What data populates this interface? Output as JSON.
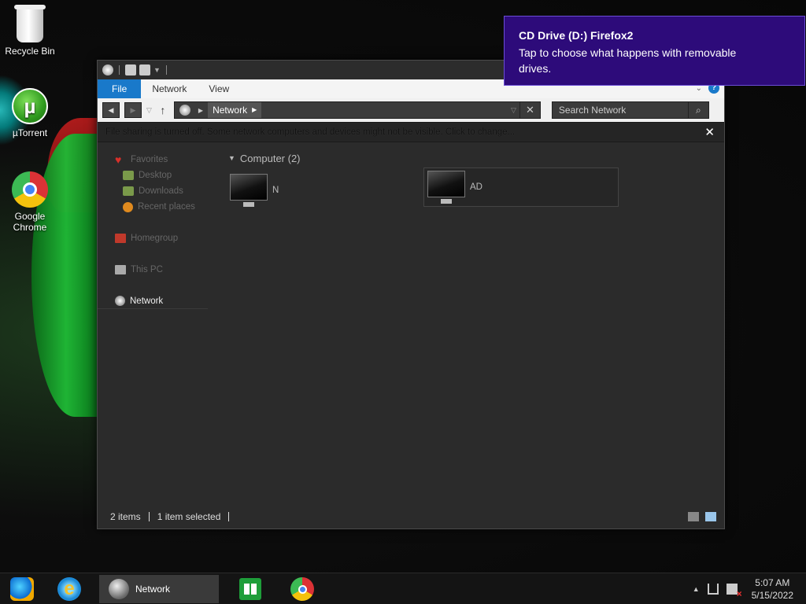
{
  "desktop": {
    "icons": [
      {
        "label": "Recycle Bin"
      },
      {
        "label": "µTorrent"
      },
      {
        "label": "Google Chrome"
      }
    ]
  },
  "window": {
    "ribbon": {
      "file": "File",
      "network": "Network",
      "view": "View"
    },
    "address": {
      "crumb": "Network"
    },
    "search": {
      "placeholder": "Search Network"
    },
    "infobar": "File sharing is turned off. Some network computers and devices might not be visible. Click to change...",
    "nav": {
      "favorites": "Favorites",
      "desktop": "Desktop",
      "downloads": "Downloads",
      "recent": "Recent places",
      "homegroup": "Homegroup",
      "thispc": "This PC",
      "network": "Network"
    },
    "group": {
      "title": "Computer (2)"
    },
    "items": [
      {
        "name": "N"
      },
      {
        "name": "AD"
      }
    ],
    "status": {
      "count": "2 items",
      "selected": "1 item selected"
    }
  },
  "toast": {
    "title": "CD Drive (D:) Firefox2",
    "body": "Tap to choose what happens with removable drives."
  },
  "taskbar": {
    "explorer_label": "Network",
    "clock": {
      "time": "5:07 AM",
      "date": "5/15/2022"
    }
  },
  "colors": {
    "accent": "#1979ca",
    "toast_bg": "#2d0b7a",
    "taskbar": "#141414"
  }
}
